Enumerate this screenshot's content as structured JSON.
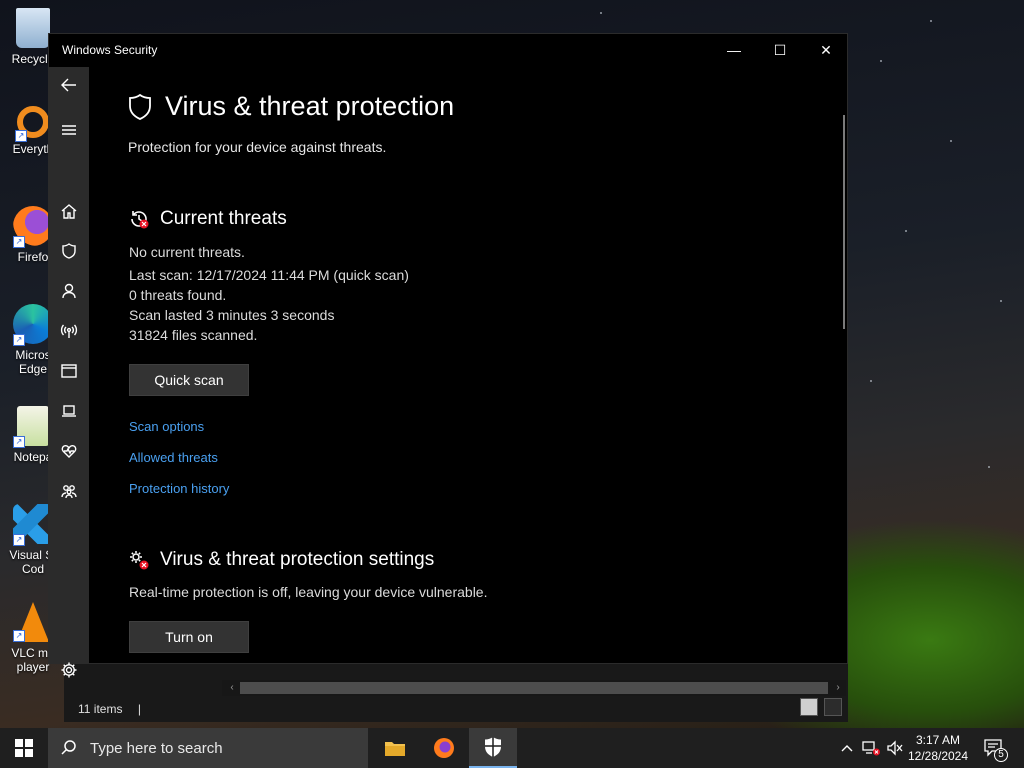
{
  "desktop": {
    "icons": [
      {
        "label": "Recycle",
        "icon": "recycle-bin-icon"
      },
      {
        "label": "Everyth",
        "icon": "everything-search-icon"
      },
      {
        "label": "Firefo",
        "icon": "firefox-icon"
      },
      {
        "label": "Micros\nEdge",
        "icon": "edge-icon"
      },
      {
        "label": "Notepa",
        "icon": "notepad-plus-icon"
      },
      {
        "label": "Visual St\nCod",
        "icon": "vscode-icon"
      },
      {
        "label": "VLC me\nplayer",
        "icon": "vlc-icon"
      }
    ]
  },
  "explorer": {
    "status_text": "11 items",
    "cursor": "|"
  },
  "window": {
    "title": "Windows Security",
    "controls": {
      "minimize": "—",
      "maximize": "☐",
      "close": "✕"
    }
  },
  "sidebar": {
    "items": [
      {
        "name": "back-arrow-icon"
      },
      {
        "name": "hamburger-menu-icon"
      },
      {
        "name": "home-icon"
      },
      {
        "name": "shield-icon"
      },
      {
        "name": "account-person-icon"
      },
      {
        "name": "firewall-network-icon"
      },
      {
        "name": "app-browser-control-icon"
      },
      {
        "name": "device-security-laptop-icon"
      },
      {
        "name": "device-health-heart-icon"
      },
      {
        "name": "family-options-icon"
      },
      {
        "name": "settings-gear-icon"
      }
    ]
  },
  "page": {
    "title": "Virus & threat protection",
    "subtitle": "Protection for your device against threats.",
    "current_threats": {
      "heading": "Current threats",
      "lines": [
        "No current threats.",
        "Last scan: 12/17/2024 11:44 PM (quick scan)",
        "0 threats found.",
        "Scan lasted 3 minutes 3 seconds",
        "31824 files scanned."
      ],
      "quick_scan_label": "Quick scan",
      "links": [
        "Scan options",
        "Allowed threats",
        "Protection history"
      ]
    },
    "settings": {
      "heading": "Virus & threat protection settings",
      "status": "Real-time protection is off, leaving your device vulnerable.",
      "turn_on_label": "Turn on"
    }
  },
  "taskbar": {
    "search_placeholder": "Type here to search",
    "clock_time": "3:17 AM",
    "clock_date": "12/28/2024",
    "notification_count": "5"
  },
  "colors": {
    "accent_link": "#4aa0f0",
    "alert_red": "#e81123",
    "taskbar_active": "#7ab4ee"
  }
}
